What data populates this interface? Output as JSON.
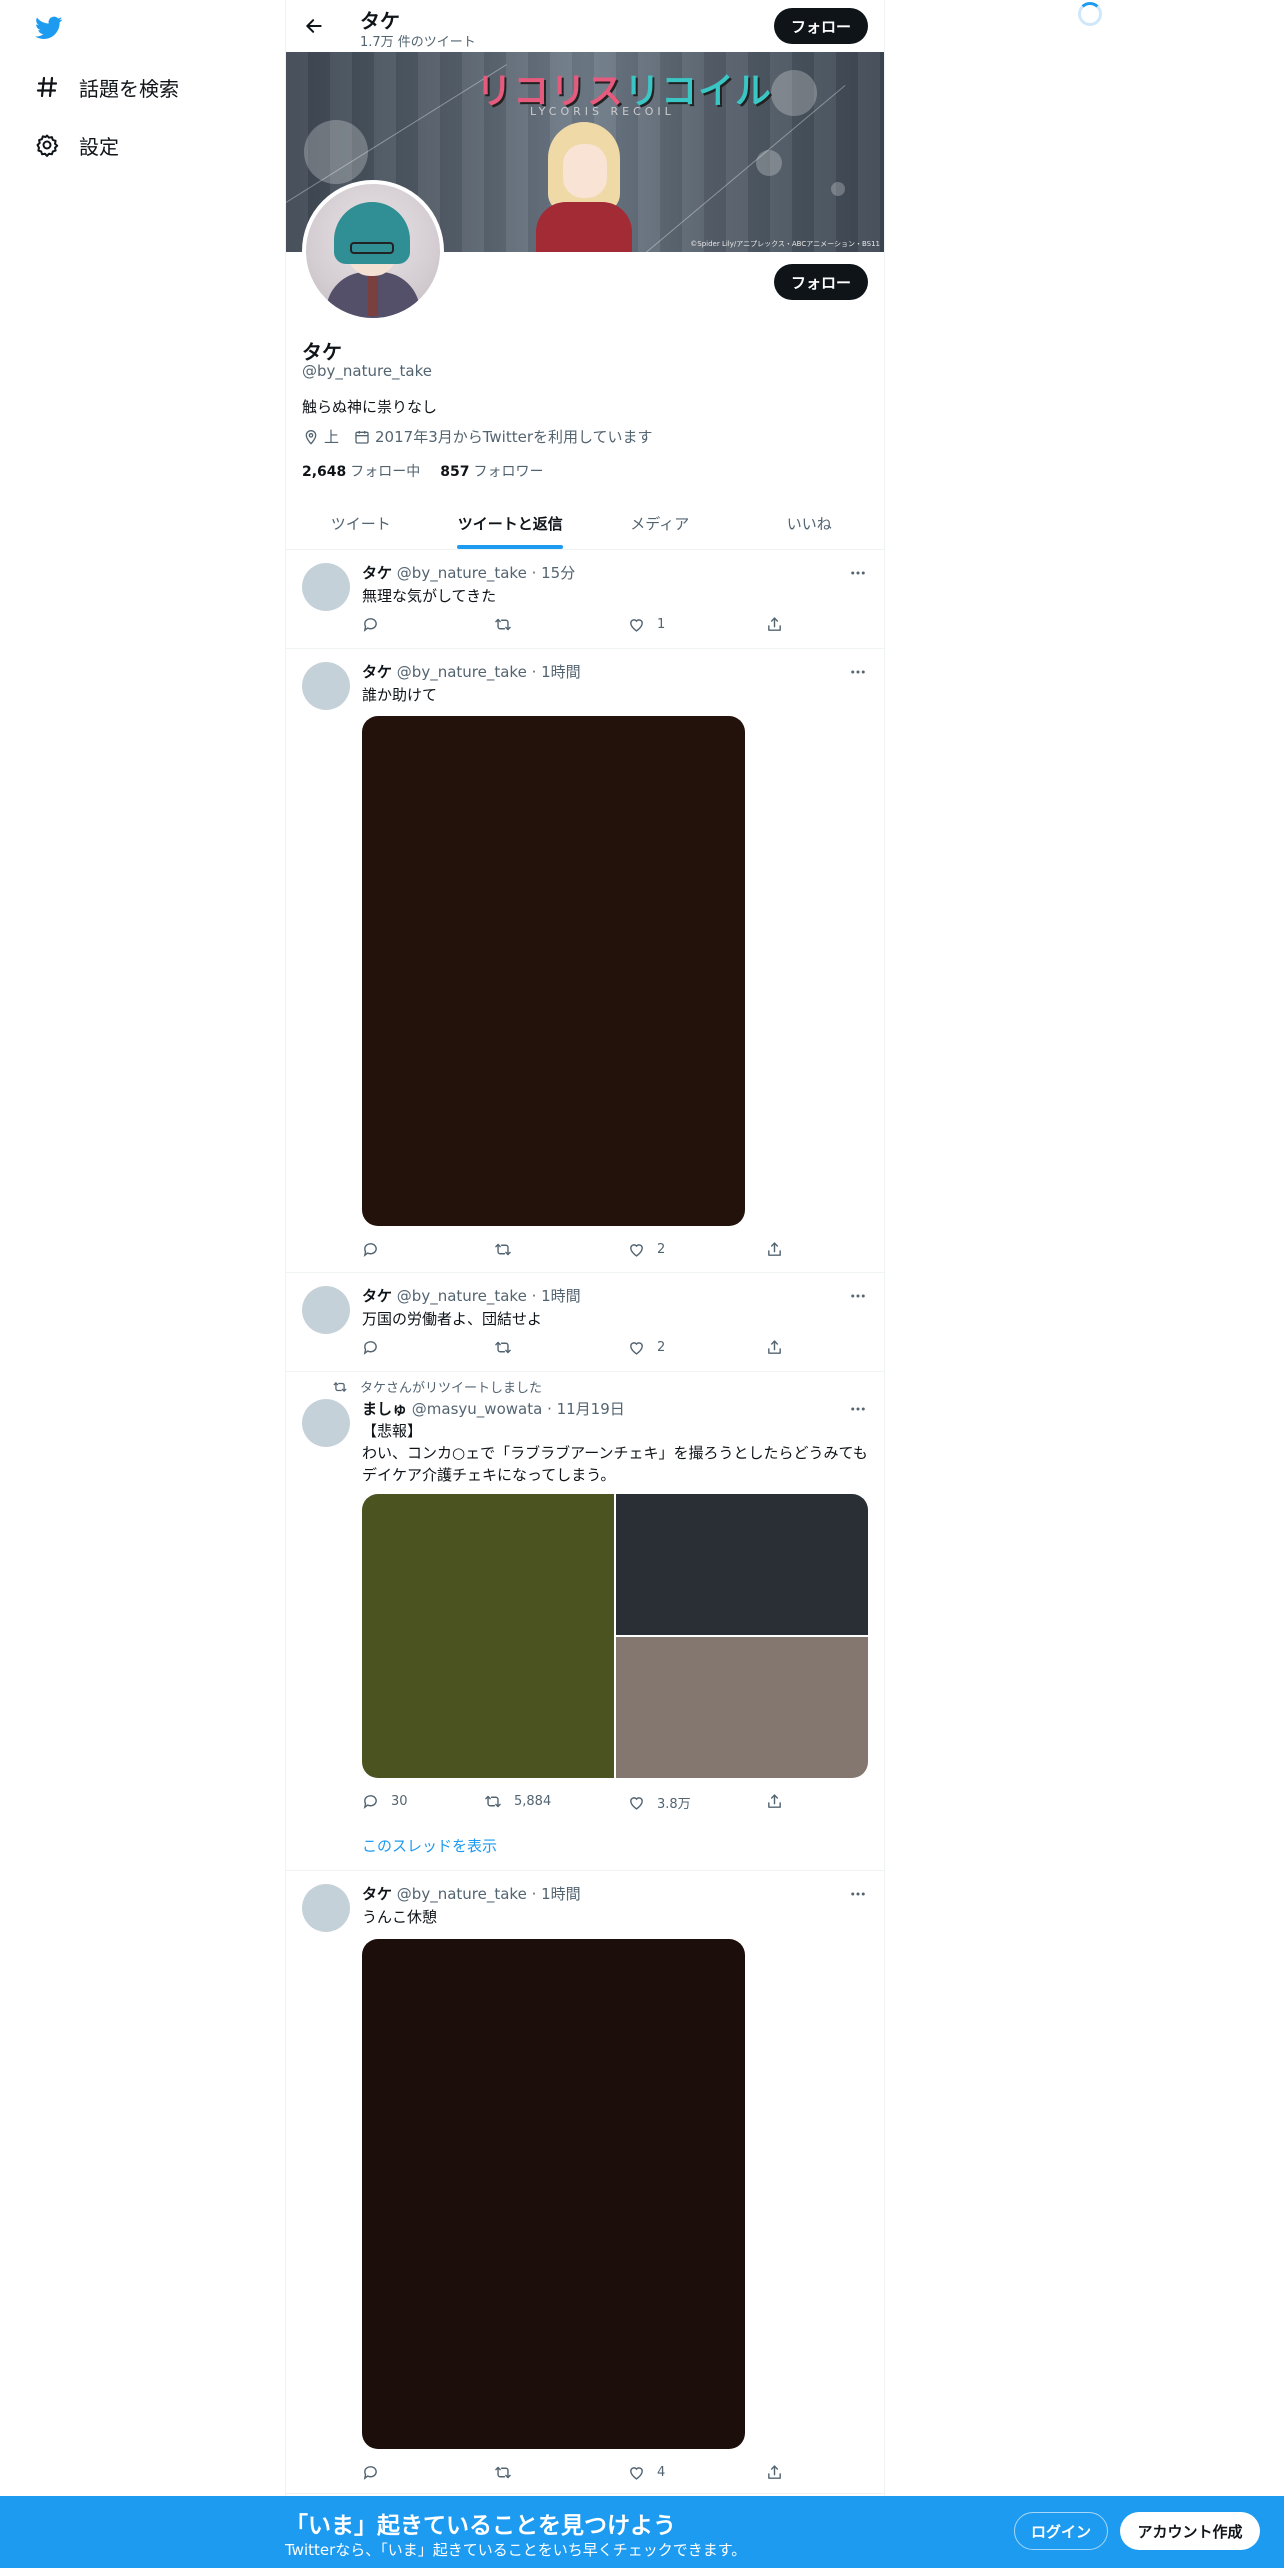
{
  "colors": {
    "accent": "#1d9bf0",
    "text": "#0f1419",
    "secondary": "#536471",
    "border": "#eff3f4"
  },
  "sidebar": {
    "logo_icon": "twitter-bird-icon",
    "items": [
      {
        "label": "話題を検索",
        "icon": "hashtag-icon"
      },
      {
        "label": "設定",
        "icon": "gear-icon"
      }
    ]
  },
  "header": {
    "name": "タケ",
    "tweet_count": "1.7万 件のツイート",
    "follow_label": "フォロー"
  },
  "banner": {
    "title_part1": "リコリス",
    "title_part2": "リコイル",
    "subtitle": "LYCORIS RECOIL",
    "credit": "©Spider Lily/アニプレックス・ABCアニメーション・BS11"
  },
  "profile": {
    "follow_label": "フォロー",
    "name": "タケ",
    "handle": "@by_nature_take",
    "bio": "触らぬ神に祟りなし",
    "location": "上",
    "joined": "2017年3月からTwitterを利用しています",
    "following_count": "2,648",
    "following_label": "フォロー中",
    "followers_count": "857",
    "followers_label": "フォロワー"
  },
  "tabs": [
    {
      "label": "ツイート",
      "active": false
    },
    {
      "label": "ツイートと返信",
      "active": true
    },
    {
      "label": "メディア",
      "active": false
    },
    {
      "label": "いいね",
      "active": false
    }
  ],
  "tweets": [
    {
      "name": "タケ",
      "handle": "@by_nature_take",
      "time": "· 15分",
      "text": "無理な気がしてきた",
      "likes": "1"
    },
    {
      "name": "タケ",
      "handle": "@by_nature_take",
      "time": "· 1時間",
      "text": "誰か助けて",
      "likes": "2",
      "media_color": "#22120b"
    },
    {
      "name": "タケ",
      "handle": "@by_nature_take",
      "time": "· 1時間",
      "text": "万国の労働者よ、団結せよ",
      "likes": "2"
    },
    {
      "retweet_label": "タケさんがリツイートしました",
      "name": "ましゅ",
      "handle": "@masyu_wowata",
      "time": "· 11月19日",
      "text_line1": "【悲報】",
      "text_line2": "わい、コンカ○ェで「ラブラブアーンチェキ」を撮ろうとしたらどうみても",
      "text_line3": "デイケア介護チェキになってしまう。",
      "replies": "30",
      "retweets": "5,884",
      "likes": "3.8万",
      "thread_link": "このスレッドを表示"
    },
    {
      "name": "タケ",
      "handle": "@by_nature_take",
      "time": "· 1時間",
      "text": "うんこ休憩",
      "likes": "4",
      "media_color": "#1c0e0b"
    }
  ],
  "bottom_bar": {
    "title": "「いま」起きていることを見つけよう",
    "subtitle": "Twitterなら、「いま」起きていることをいち早くチェックできます。",
    "login_label": "ログイン",
    "signup_label": "アカウント作成"
  }
}
